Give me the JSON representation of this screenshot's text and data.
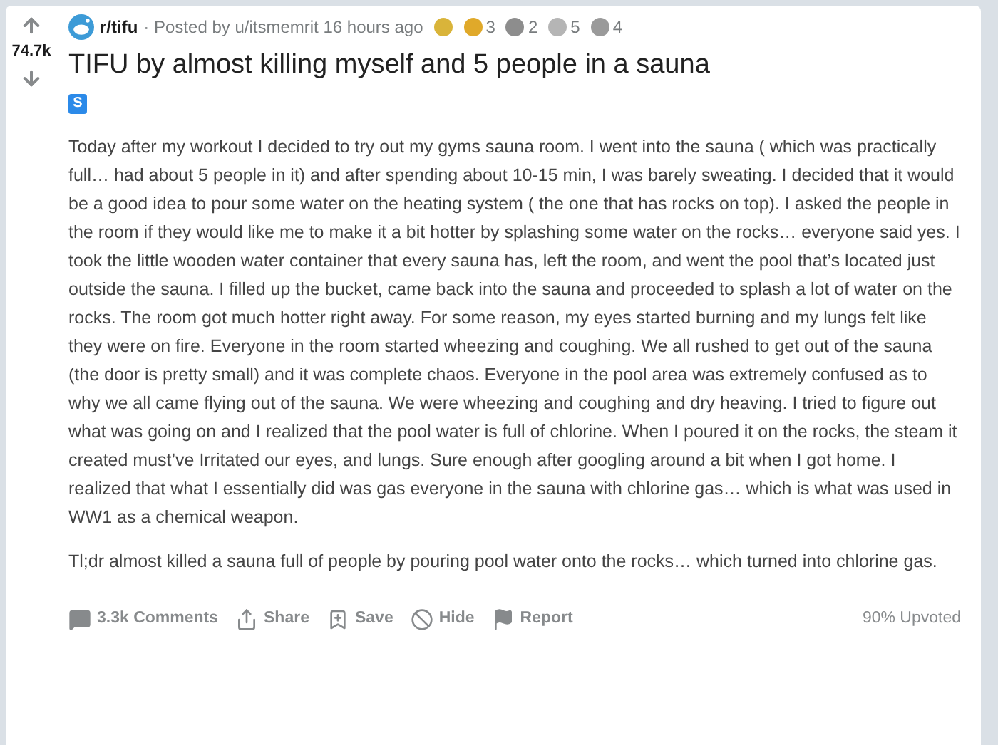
{
  "post": {
    "votes": "74.7k",
    "subreddit": "r/tifu",
    "posted_by": "· Posted by u/itsmemrit 16 hours ago",
    "awards": [
      {
        "color": "#d9b43a"
      },
      {
        "color": "#e0a92a",
        "count": "3"
      },
      {
        "color": "#8d8d8d",
        "count": "2"
      },
      {
        "color": "#b5b5b5",
        "count": "5"
      },
      {
        "color": "#9a9a9a",
        "count": "4"
      }
    ],
    "title": "TIFU by almost killing myself and 5 people in a sauna",
    "flair": "S",
    "paragraphs": [
      "Today after my workout I decided to try out my gyms sauna room. I went into the sauna ( which was practically full… had about 5 people in it) and after spending about 10-15 min, I was barely sweating. I decided that it would be a good idea to pour some water on the heating system ( the one that has rocks on top). I asked the people in the room if they would like me to make it a bit hotter by splashing some water on the rocks… everyone said yes. I took the little wooden water container that every sauna has, left the room, and went the pool that’s located just outside the sauna. I filled up the bucket, came back into the sauna and proceeded to splash a lot of water on the rocks. The room got much hotter right away. For some reason, my eyes started burning and my lungs felt like they were on fire. Everyone in the room started wheezing and coughing. We all rushed to get out of the sauna (the door is pretty small) and it was complete chaos. Everyone in the pool area was extremely confused as to why we all came flying out of the sauna. We were wheezing and coughing and dry heaving. I tried to figure out what was going on and I realized that the pool water is full of chlorine. When I poured it on the rocks, the steam it created must’ve Irritated our eyes, and lungs. Sure enough after googling around a bit when I got home. I realized that what I essentially did was gas everyone in the sauna with chlorine gas… which is what was used in WW1 as a chemical weapon.",
      "Tl;dr almost killed a sauna full of people by pouring pool water onto the rocks… which turned into chlorine gas."
    ],
    "actions": [
      {
        "kind": "comments",
        "label": "3.3k Comments"
      },
      {
        "kind": "share",
        "label": "Share"
      },
      {
        "kind": "save",
        "label": "Save"
      },
      {
        "kind": "hide",
        "label": "Hide"
      },
      {
        "kind": "report",
        "label": "Report"
      }
    ],
    "upvoted": "90% Upvoted"
  }
}
